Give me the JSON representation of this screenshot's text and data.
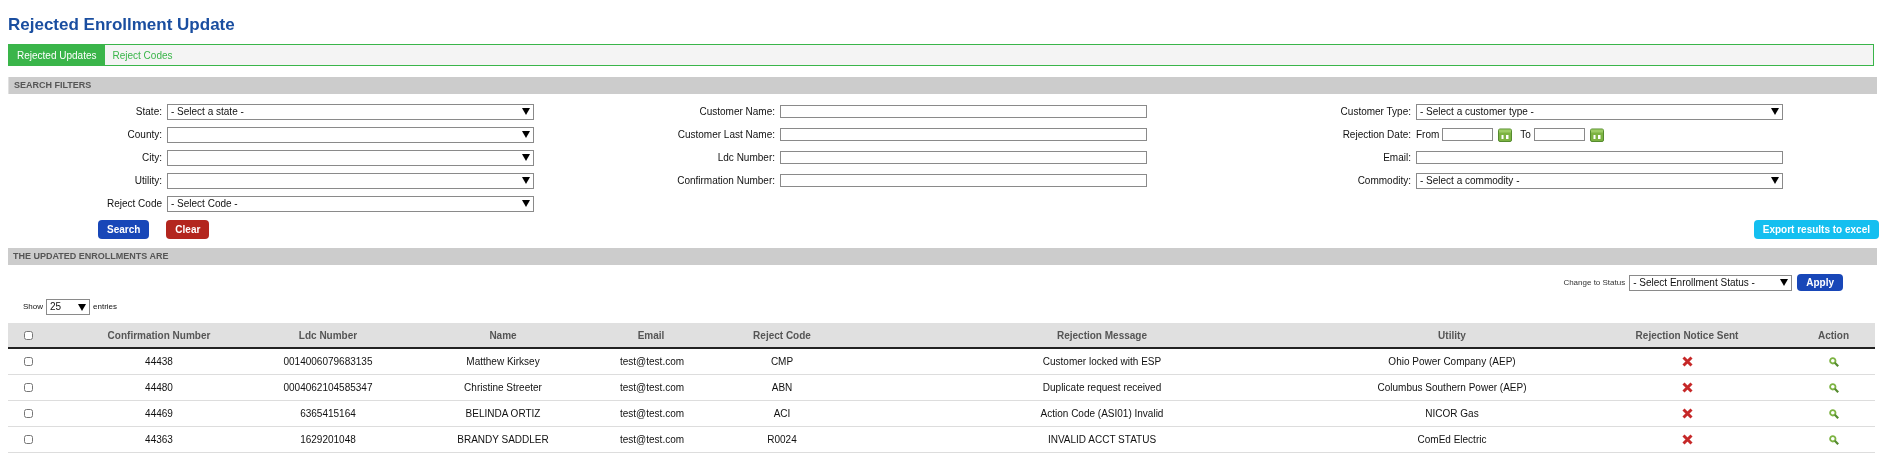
{
  "title": "Rejected Enrollment Update",
  "tabs": [
    {
      "label": "Rejected Updates",
      "selected": true
    },
    {
      "label": "Reject Codes",
      "selected": false
    }
  ],
  "search_filters": {
    "heading": "SEARCH FILTERS",
    "columns": [
      [
        {
          "kind": "select",
          "label": "State:",
          "value": "- Select a state -"
        },
        {
          "kind": "select",
          "label": "County:"
        },
        {
          "kind": "select",
          "label": "City:"
        },
        {
          "kind": "select",
          "label": "Utility:"
        },
        {
          "kind": "select",
          "label": "Reject Code",
          "value": "- Select Code -"
        }
      ],
      [
        {
          "kind": "input",
          "label": "Customer Name:"
        },
        {
          "kind": "input",
          "label": "Customer Last Name:"
        },
        {
          "kind": "input",
          "label": "Ldc Number:"
        },
        {
          "kind": "input",
          "label": "Confirmation Number:"
        }
      ],
      [
        {
          "kind": "select",
          "label": "Customer Type:",
          "value": "- Select a customer type -"
        },
        {
          "kind": "daterange",
          "label": "Rejection Date:",
          "from": "From",
          "to": "To"
        },
        {
          "kind": "input",
          "label": "Email:"
        },
        {
          "kind": "select",
          "label": "Commodity:",
          "value": "- Select a commodity -"
        }
      ]
    ],
    "buttons": [
      {
        "label": "Search",
        "kind": "primary"
      },
      {
        "label": "Clear",
        "kind": "danger"
      }
    ],
    "export_button": "Export results to excel"
  },
  "results": {
    "heading": "THE UPDATED ENROLLMENTS ARE",
    "change_status": {
      "label": "Change to Status",
      "value": "- Select Enrollment Status -",
      "button": "Apply"
    },
    "show_entries": {
      "before": "Show",
      "value": "25",
      "after": "entries"
    }
  },
  "table": {
    "select_all_checked": false,
    "columns": [
      "Confirmation Number",
      "Ldc Number",
      "Name",
      "Email",
      "Reject Code",
      "Rejection Message",
      "Utility",
      "Rejection Notice Sent",
      "Action"
    ],
    "rows": [
      {
        "checked": false,
        "cells": [
          "44438",
          "0014006079683135",
          "Matthew Kirksey",
          "test@test.com",
          "CMP",
          "Customer locked with ESP",
          "Ohio Power Company (AEP)"
        ],
        "notice_sent": false
      },
      {
        "checked": false,
        "cells": [
          "44480",
          "0004062104585347",
          "Christine Streeter",
          "test@test.com",
          "ABN",
          "Duplicate request received",
          "Columbus Southern Power (AEP)"
        ],
        "notice_sent": false
      },
      {
        "checked": false,
        "cells": [
          "44469",
          "6365415164",
          "BELINDA ORTIZ",
          "test@test.com",
          "ACI",
          "Action Code (ASI01) Invalid",
          "NICOR Gas"
        ],
        "notice_sent": false
      },
      {
        "checked": false,
        "cells": [
          "44363",
          "1629201048",
          "BRANDY SADDLER",
          "test@test.com",
          "R0024",
          "INVALID ACCT STATUS",
          "ComEd Electric"
        ],
        "notice_sent": false
      }
    ]
  }
}
